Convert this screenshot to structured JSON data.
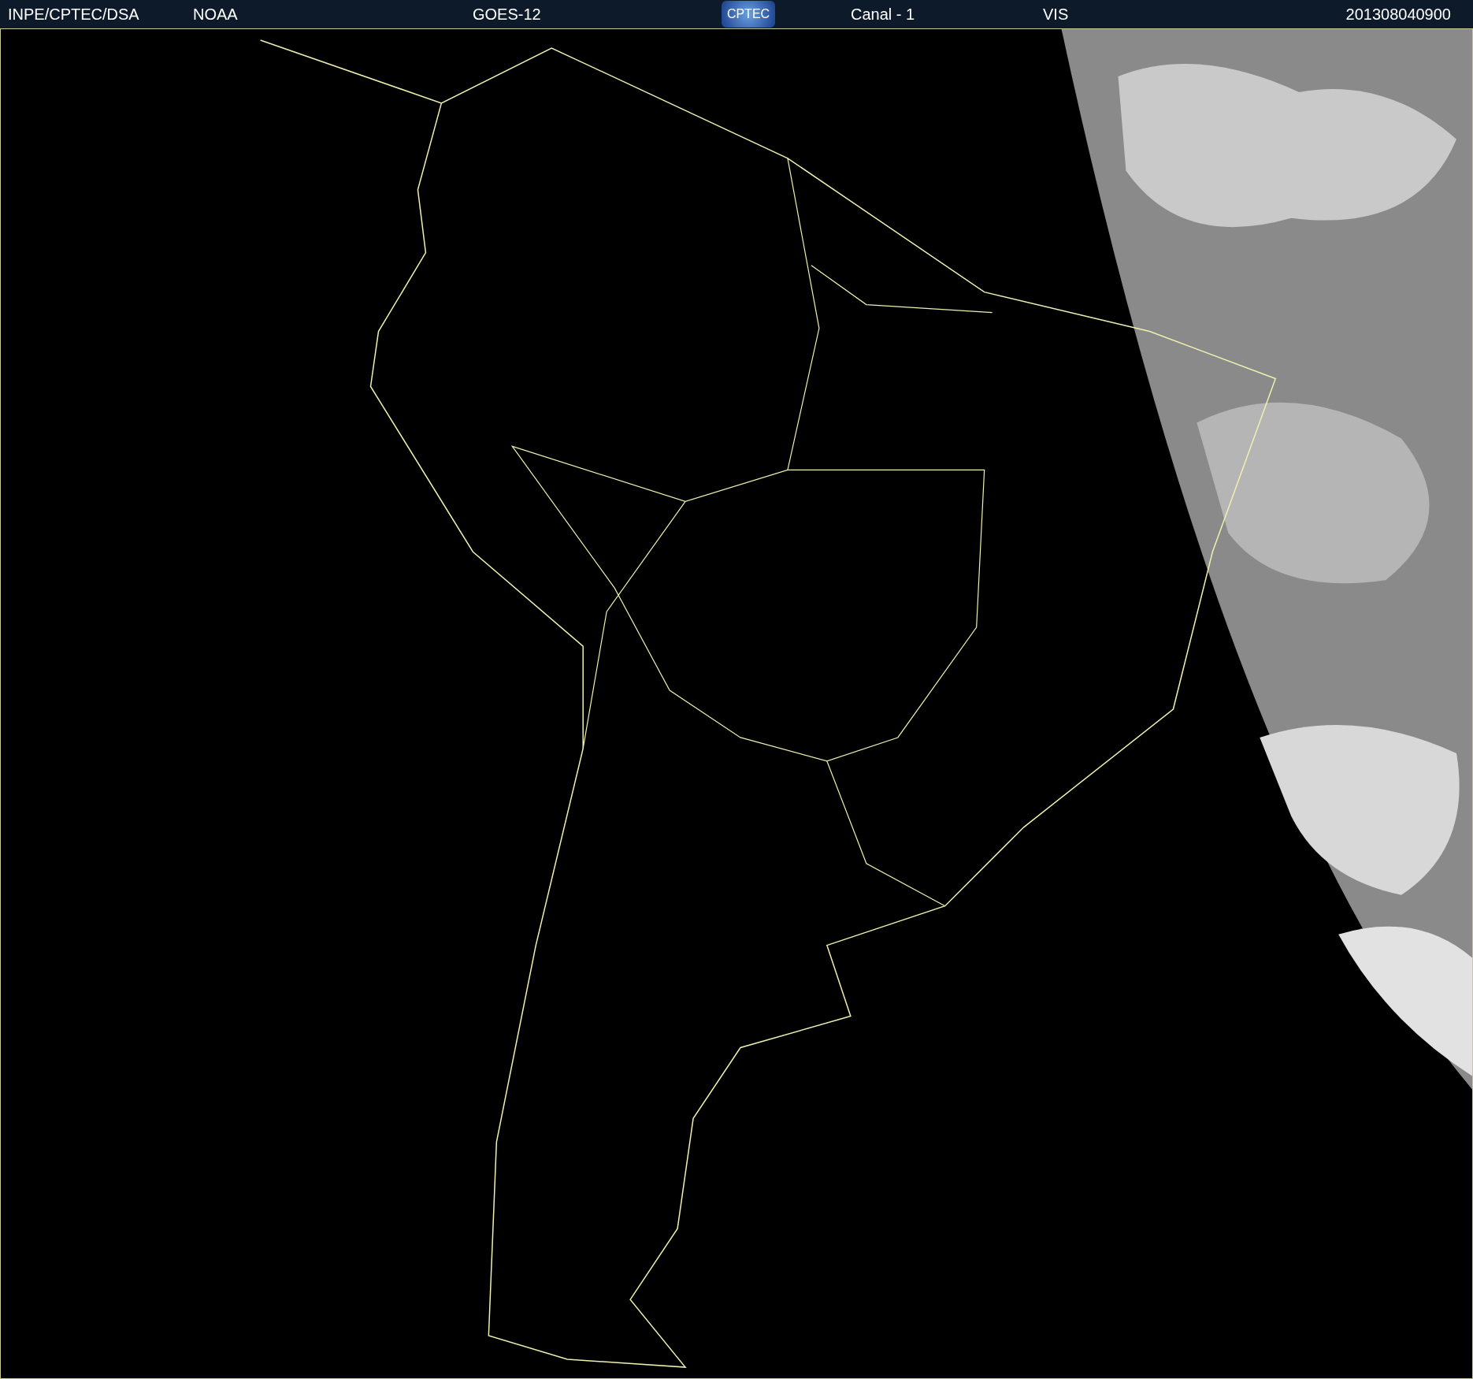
{
  "header": {
    "source": "INPE/CPTEC/DSA",
    "agency": "NOAA",
    "satellite": "GOES-12",
    "logo": "CPTEC",
    "channel": "Canal - 1",
    "band": "VIS",
    "timestamp": "201308040900"
  }
}
